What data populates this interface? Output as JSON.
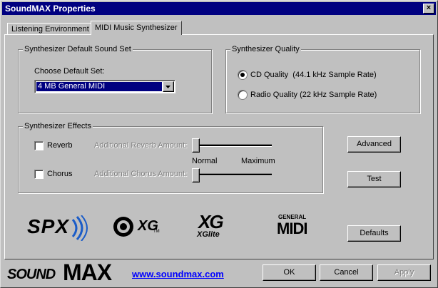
{
  "window": {
    "title": "SoundMAX Properties",
    "close_label": "×"
  },
  "tabs": [
    {
      "label": "Listening Environment",
      "active": false
    },
    {
      "label": "MIDI Music Synthesizer",
      "active": true
    }
  ],
  "sound_set": {
    "legend": "Synthesizer Default Sound Set",
    "choose_label": "Choose Default Set:",
    "selected": "4 MB General MIDI"
  },
  "quality": {
    "legend": "Synthesizer Quality",
    "options": [
      {
        "label": "CD Quality  (44.1 kHz Sample Rate)",
        "checked": true
      },
      {
        "label": "Radio Quality (22 kHz Sample Rate)",
        "checked": false
      }
    ]
  },
  "effects": {
    "legend": "Synthesizer Effects",
    "reverb_label": "Reverb",
    "reverb_amount_label": "Additional Reverb Amount:",
    "chorus_label": "Chorus",
    "chorus_amount_label": "Additional Chorus Amount:",
    "scale_min": "Normal",
    "scale_max": "Maximum",
    "reverb_level": 0,
    "chorus_level": 0
  },
  "buttons": {
    "advanced": "Advanced",
    "test": "Test",
    "defaults": "Defaults",
    "ok": "OK",
    "cancel": "Cancel",
    "apply": "Apply"
  },
  "logos": {
    "spx": "SPX",
    "xg": "XG",
    "xg_tm": "TM",
    "xglite_top": "XG",
    "xglite_bottom": "XGlite",
    "gm_top": "GENERAL",
    "gm_bottom": "MIDI",
    "brand_small": "SOUND",
    "brand_big": "MAX"
  },
  "link": "www.soundmax.com",
  "colors": {
    "title_bar": "#000080",
    "selection": "#000080",
    "link": "#0000ff"
  }
}
